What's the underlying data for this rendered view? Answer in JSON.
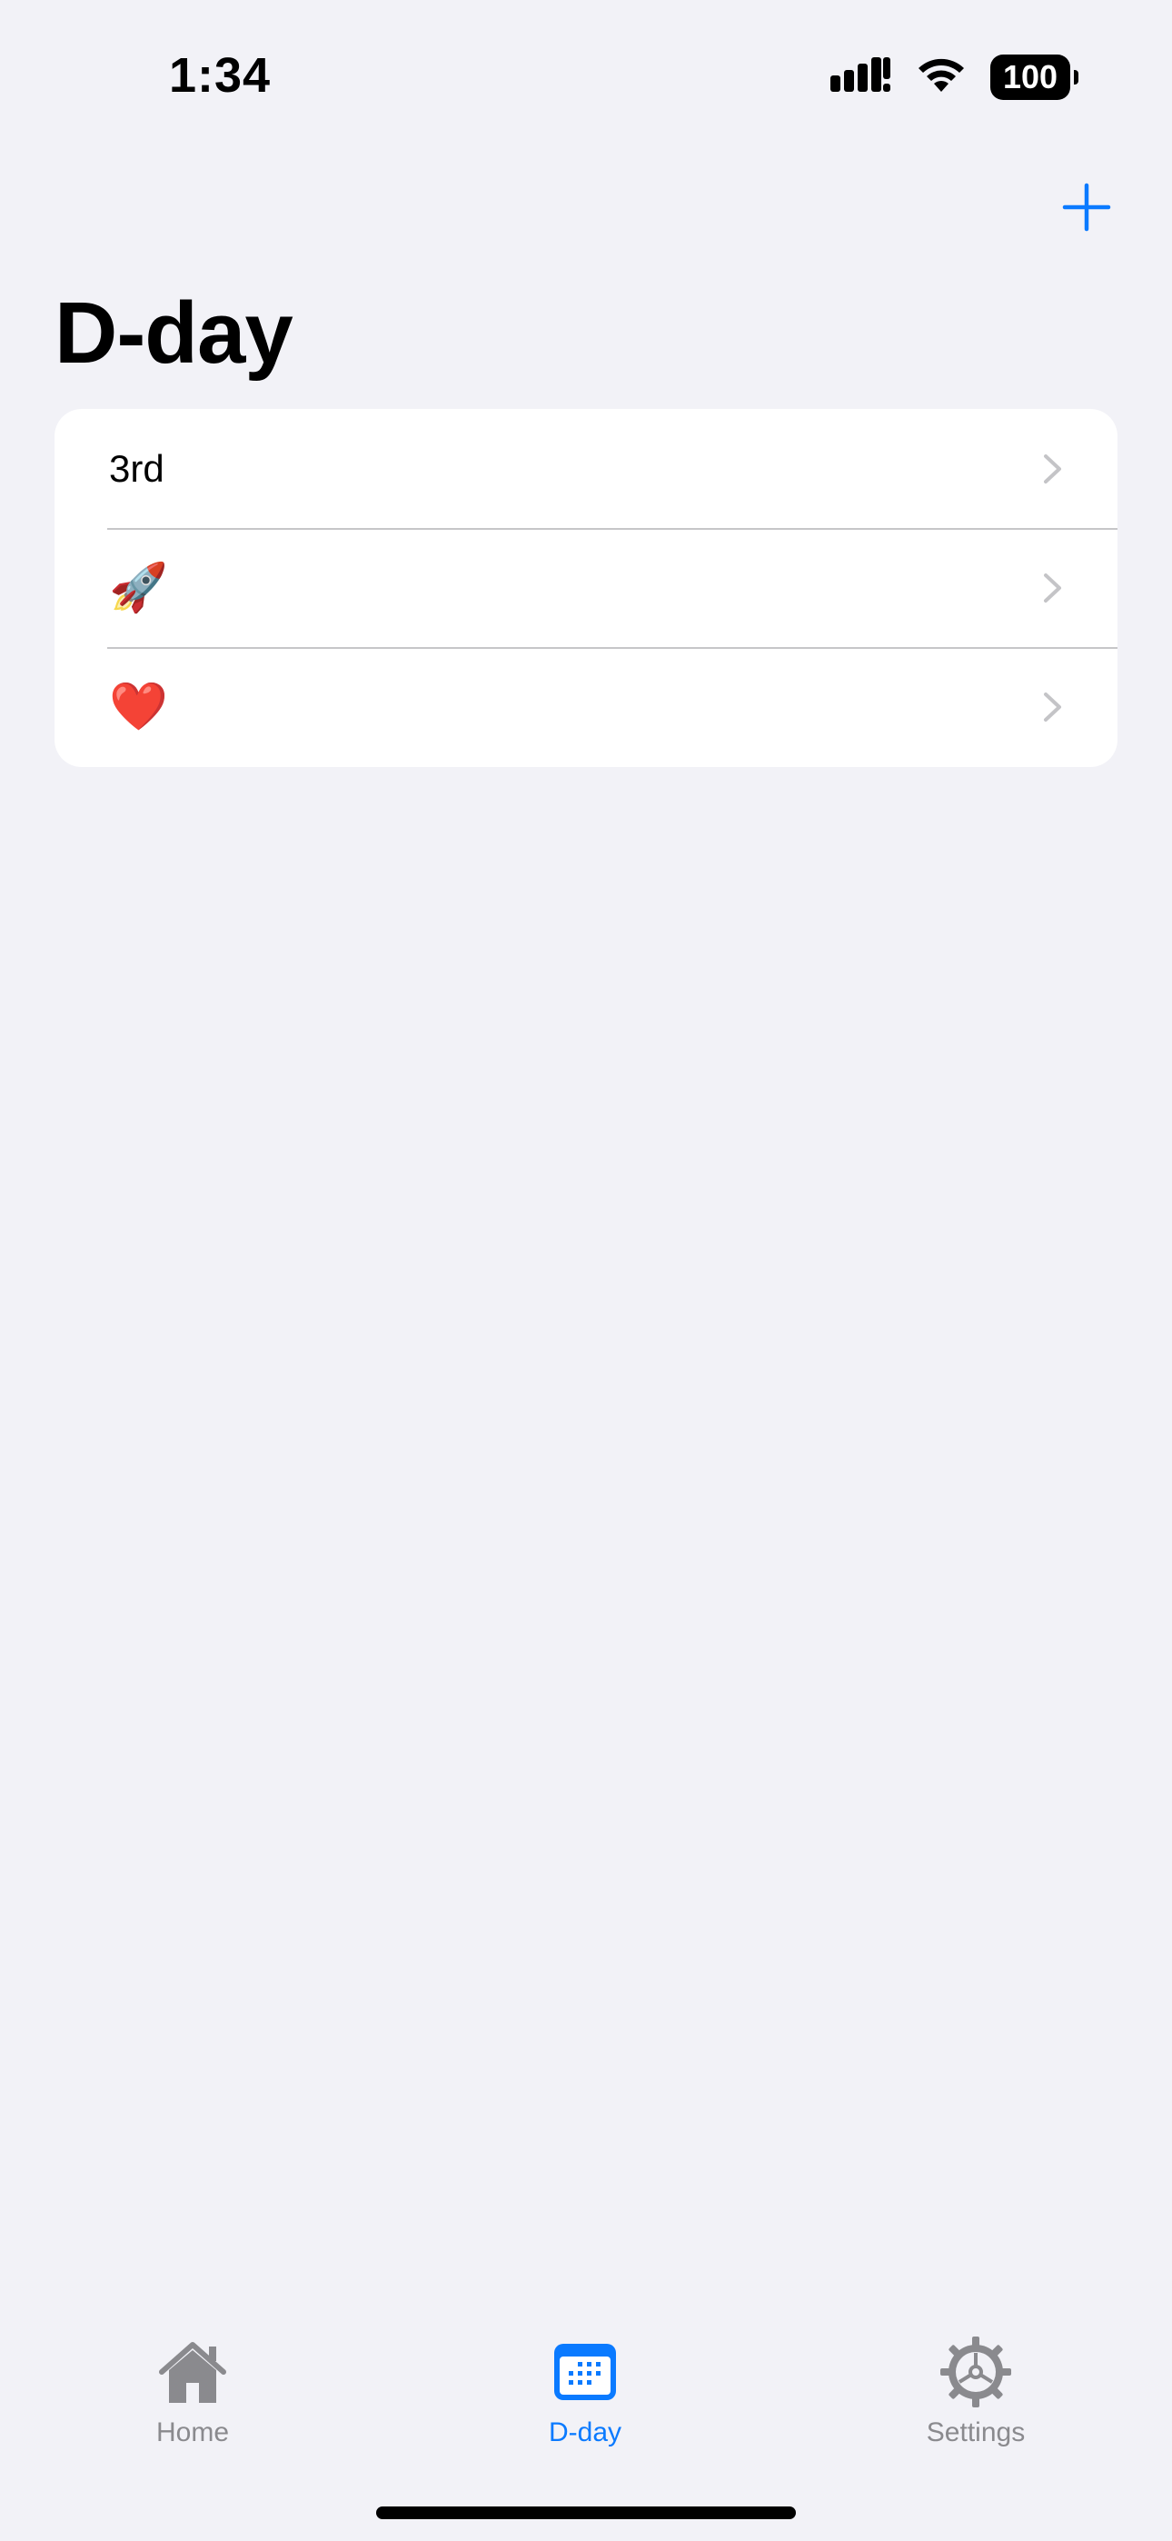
{
  "status_bar": {
    "time": "1:34",
    "battery": "100"
  },
  "navigation": {
    "title": "D-day",
    "add_icon": "plus-icon"
  },
  "list": {
    "items": [
      {
        "label": "3rd",
        "chevron_icon": "chevron-right-icon"
      },
      {
        "label": "🚀",
        "chevron_icon": "chevron-right-icon"
      },
      {
        "label": "❤️",
        "chevron_icon": "chevron-right-icon"
      }
    ]
  },
  "tab_bar": {
    "tabs": [
      {
        "label": "Home",
        "icon": "house-icon",
        "active": false
      },
      {
        "label": "D-day",
        "icon": "calendar-icon",
        "active": true
      },
      {
        "label": "Settings",
        "icon": "gear-icon",
        "active": false
      }
    ]
  },
  "colors": {
    "accent": "#0A7AFF",
    "background": "#F2F2F7",
    "inactive_tab": "#8A8A8E",
    "separator": "#C6C6C8",
    "chevron": "#C4C4C7"
  }
}
